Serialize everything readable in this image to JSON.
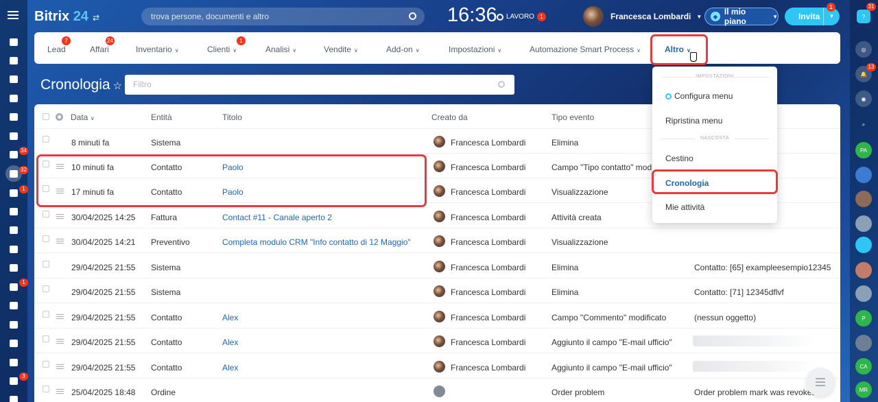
{
  "header": {
    "logo_main": "Bitrix",
    "logo_num": "24",
    "search_placeholder": "trova persone, documenti e altro",
    "clock": "16:36",
    "work_status": "LAVORO",
    "work_badge": "1",
    "user_name": "Francesca Lombardi",
    "plan_label": "Il mio piano",
    "invite_label": "Invita",
    "invite_badge": "1"
  },
  "left_nav": {
    "badges": {
      "tasks": "34",
      "crm": "32",
      "contact": "1",
      "mail": "1",
      "cart": "3"
    }
  },
  "right_nav": {
    "help_badge": "31",
    "notifications_badge": "13",
    "avatars": [
      "PA",
      "P",
      "CA",
      "MR"
    ]
  },
  "top_menu": [
    {
      "label": "Lead",
      "badge": "7"
    },
    {
      "label": "Affari",
      "badge": "24"
    },
    {
      "label": "Inventario",
      "dropdown": true
    },
    {
      "label": "Clienti",
      "badge": "1",
      "dropdown": true
    },
    {
      "label": "Analisi",
      "dropdown": true
    },
    {
      "label": "Vendite",
      "dropdown": true
    },
    {
      "label": "Add-on",
      "dropdown": true
    },
    {
      "label": "Impostazioni",
      "dropdown": true
    },
    {
      "label": "Automazione Smart Process",
      "dropdown": true
    },
    {
      "label": "Altro",
      "dropdown": true,
      "active": true
    }
  ],
  "page": {
    "title": "Cronologia",
    "filter_placeholder": "Filtro"
  },
  "grid": {
    "headers": [
      "Data",
      "Entità",
      "Titolo",
      "Creato da",
      "Tipo evento"
    ],
    "rows": [
      {
        "date": "8 minuti fa",
        "entity": "Sistema",
        "title": "",
        "author": "Francesca Lombardi",
        "event": "Elimina",
        "details": ""
      },
      {
        "date": "10 minuti fa",
        "entity": "Contatto",
        "title": "Paolo",
        "author": "Francesca Lombardi",
        "event": "Campo \"Tipo contatto\" modificato",
        "details": ""
      },
      {
        "date": "17 minuti fa",
        "entity": "Contatto",
        "title": "Paolo",
        "author": "Francesca Lombardi",
        "event": "Visualizzazione",
        "details": ""
      },
      {
        "date": "30/04/2025 14:25",
        "entity": "Fattura",
        "title": "Contact #11 - Canale aperto 2",
        "author": "Francesca Lombardi",
        "event": "Attività creata",
        "details": ""
      },
      {
        "date": "30/04/2025 14:21",
        "entity": "Preventivo",
        "title": "Completa modulo CRM \"Info contatto di 12 Maggio\"",
        "author": "Francesca Lombardi",
        "event": "Visualizzazione",
        "details": ""
      },
      {
        "date": "29/04/2025 21:55",
        "entity": "Sistema",
        "title": "",
        "author": "Francesca Lombardi",
        "event": "Elimina",
        "details": "Contatto: [65] exampleesempio12345"
      },
      {
        "date": "29/04/2025 21:55",
        "entity": "Sistema",
        "title": "",
        "author": "Francesca Lombardi",
        "event": "Elimina",
        "details": "Contatto: [71] 12345dflvf"
      },
      {
        "date": "29/04/2025 21:55",
        "entity": "Contatto",
        "title": "Alex",
        "author": "Francesca Lombardi",
        "event": "Campo \"Commento\" modificato",
        "details": "(nessun oggetto)"
      },
      {
        "date": "29/04/2025 21:55",
        "entity": "Contatto",
        "title": "Alex",
        "author": "Francesca Lombardi",
        "event": "Aggiunto il campo \"E-mail ufficio\"",
        "details": ""
      },
      {
        "date": "29/04/2025 21:55",
        "entity": "Contatto",
        "title": "Alex",
        "author": "Francesca Lombardi",
        "event": "Aggiunto il campo \"E-mail ufficio\"",
        "details": ""
      },
      {
        "date": "25/04/2025 18:48",
        "entity": "Ordine",
        "title": "",
        "author": "",
        "event": "Order problem",
        "details": "Order problem mark was revoked."
      }
    ]
  },
  "dropdown": {
    "section_settings": "IMPOSTAZIONI",
    "configure": "Configura menu",
    "reset": "Ripristina menu",
    "section_hidden": "NASCOSTA",
    "trash": "Cestino",
    "history": "Cronologia",
    "my_tasks": "Mie attività"
  },
  "colors": {
    "accent": "#2067b0",
    "highlight": "#e8393d",
    "badge": "#f0371b",
    "invite": "#2fc6f6"
  }
}
